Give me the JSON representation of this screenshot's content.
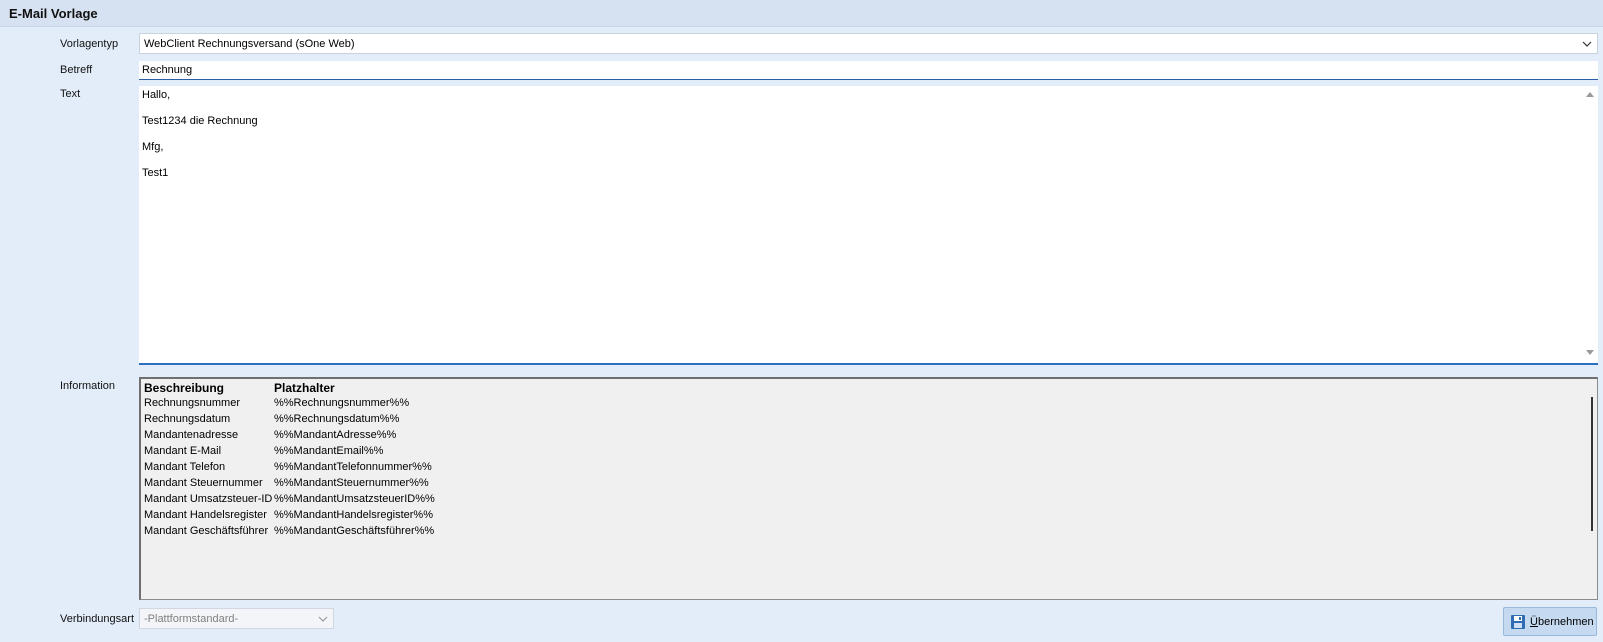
{
  "window": {
    "title": "E-Mail Vorlage"
  },
  "form": {
    "vorlagentyp": {
      "label": "Vorlagentyp",
      "value": "WebClient Rechnungsversand (sOne Web)"
    },
    "betreff": {
      "label": "Betreff",
      "value": "Rechnung"
    },
    "text": {
      "label": "Text",
      "lines": [
        "Hallo,",
        "Test1234 die Rechnung",
        "Mfg,",
        "Test1"
      ]
    },
    "information": {
      "label": "Information",
      "headers": [
        "Beschreibung",
        "Platzhalter"
      ],
      "rows": [
        [
          "Rechnungsnummer",
          "%%Rechnungsnummer%%"
        ],
        [
          "Rechnungsdatum",
          "%%Rechnungsdatum%%"
        ],
        [
          "Mandantenadresse",
          "%%MandantAdresse%%"
        ],
        [
          "Mandant E-Mail",
          "%%MandantEmail%%"
        ],
        [
          "Mandant Telefon",
          "%%MandantTelefonnummer%%"
        ],
        [
          "Mandant Steuernummer",
          "%%MandantSteuernummer%%"
        ],
        [
          "Mandant Umsatzsteuer-ID",
          "%%MandantUmsatzsteuerID%%"
        ],
        [
          "Mandant Handelsregister",
          "%%MandantHandelsregister%%"
        ],
        [
          "Mandant Geschäftsführer",
          "%%MandantGeschäftsführer%%"
        ]
      ]
    },
    "verbindungsart": {
      "label": "Verbindungsart",
      "value": "-Plattformstandard-"
    }
  },
  "actions": {
    "apply": {
      "label_first": "Ü",
      "label_rest": "bernehmen",
      "icon": "save-icon"
    }
  },
  "colors": {
    "background": "#e3edf9",
    "accent": "#2a6fc0"
  }
}
